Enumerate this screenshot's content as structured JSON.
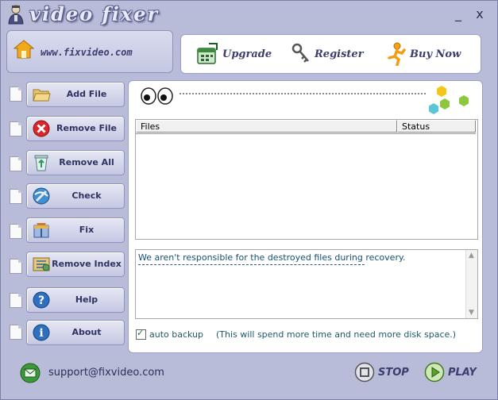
{
  "window": {
    "title": "video fixer",
    "minimize_label": "_",
    "close_label": "x"
  },
  "banner": {
    "website": "www.fixvideo.com"
  },
  "top_menu": {
    "upgrade": "Upgrade",
    "register": "Register",
    "buy_now": "Buy Now"
  },
  "sidebar": {
    "items": [
      {
        "label": "Add File",
        "icon": "folder-icon"
      },
      {
        "label": "Remove File",
        "icon": "remove-icon"
      },
      {
        "label": "Remove All",
        "icon": "recycle-bin-icon"
      },
      {
        "label": "Check",
        "icon": "check-icon"
      },
      {
        "label": "Fix",
        "icon": "fix-icon"
      },
      {
        "label": "Remove Index",
        "icon": "remove-index-icon"
      },
      {
        "label": "Help",
        "icon": "help-icon"
      },
      {
        "label": "About",
        "icon": "info-icon"
      }
    ]
  },
  "files_table": {
    "columns": [
      "Files",
      "Status"
    ],
    "rows": []
  },
  "log": {
    "message": "We aren't responsible for the destroyed files during recovery."
  },
  "backup": {
    "label": "auto backup",
    "checked": true,
    "note": "(This will spend more time and need more disk space.)"
  },
  "footer": {
    "support_email": "support@fixvideo.com",
    "stop": "STOP",
    "play": "PLAY"
  },
  "colors": {
    "window_bg": "#b9bcd9",
    "text_dark": "#2f3360",
    "log_text": "#165070"
  }
}
